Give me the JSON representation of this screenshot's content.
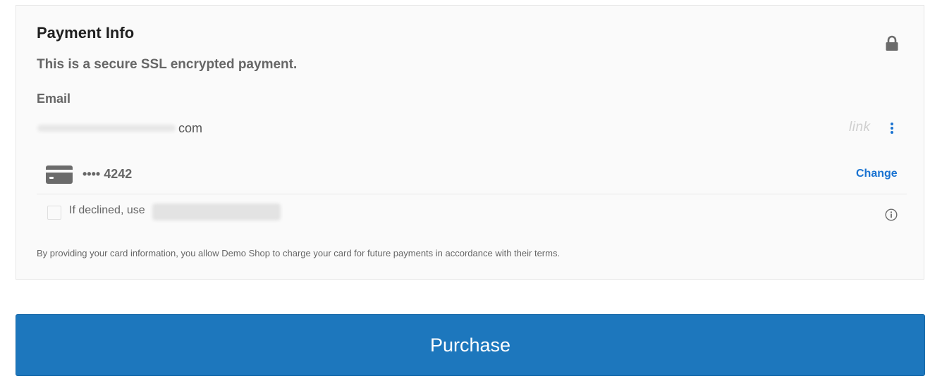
{
  "payment": {
    "title": "Payment Info",
    "secure_text": "This is a secure SSL encrypted payment.",
    "email_label": "Email",
    "email_suffix": "com",
    "link_logo": "link",
    "card_number": "•••• 4242",
    "change_label": "Change",
    "declined_label": "If declined, use",
    "terms": "By providing your card information, you allow Demo Shop to charge your card for future payments in accordance with their terms."
  },
  "purchase_button": {
    "label": "Purchase"
  },
  "icons": {
    "lock": "lock-icon",
    "menu": "more-vertical-icon",
    "card": "credit-card-icon",
    "info": "info-icon"
  },
  "colors": {
    "accent": "#1a73d1",
    "purchase_bg": "#1d77bd",
    "panel_bg": "#fafafa"
  }
}
